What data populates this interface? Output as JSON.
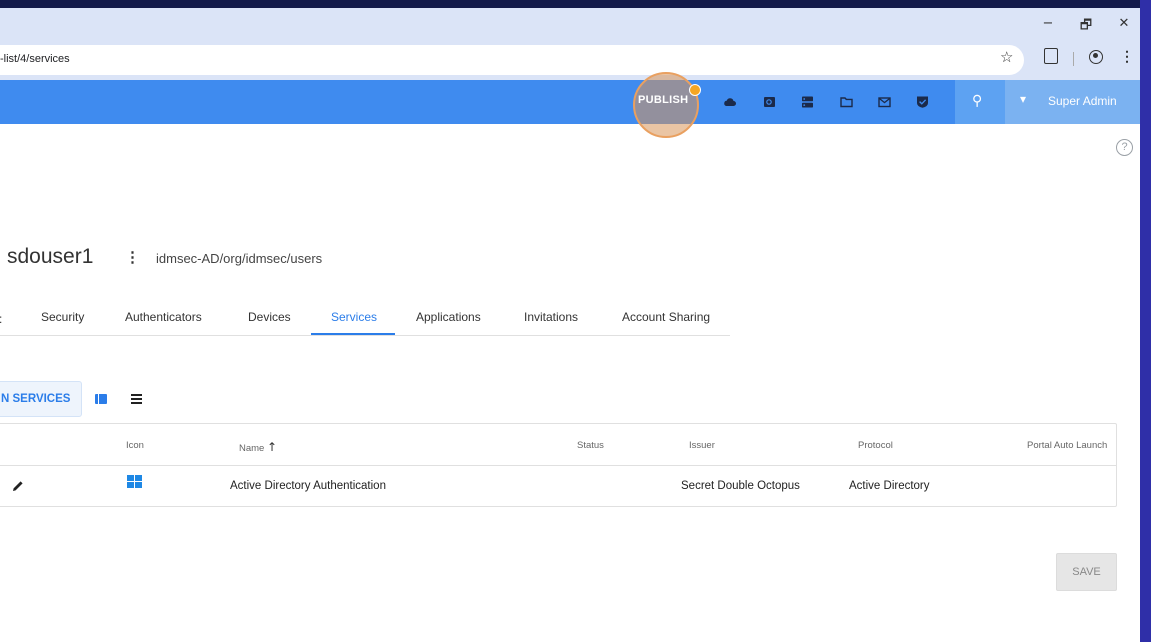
{
  "browser": {
    "url": "-list/4/services",
    "window_controls": {
      "minimize": "−",
      "restore": "🗗",
      "close": "✕"
    },
    "toolbar_icons": [
      "star-icon",
      "extensions-icon",
      "profile-icon",
      "menu-icon"
    ]
  },
  "header": {
    "publish_label": "PUBLISH",
    "nav_icons": [
      "cloud-icon",
      "search-doc-icon",
      "server-icon",
      "folder-icon",
      "mail-icon",
      "shield-check-icon"
    ],
    "search_icon": "search-icon",
    "admin_label": "Super Admin",
    "colors": {
      "bar": "#3f8bef",
      "search_zone": "#5da2f2",
      "admin_zone": "#7bb2f1",
      "publish_badge": "#f5a623"
    }
  },
  "user": {
    "name": "sdouser1",
    "menu_glyph": "⋮",
    "path": "idmsec-AD/org/idmsec/users"
  },
  "tabs": {
    "partial": ":",
    "items": [
      "Security",
      "Authenticators",
      "Devices",
      "Services",
      "Applications",
      "Invitations",
      "Account Sharing"
    ],
    "active": "Services"
  },
  "services": {
    "assign_label": "N SERVICES",
    "columns": {
      "icon": "Icon",
      "name": "Name",
      "name_sort": "↑",
      "status": "Status",
      "issuer": "Issuer",
      "protocol": "Protocol",
      "auto_launch": "Portal Auto Launch"
    },
    "rows": [
      {
        "icon": "windows-logo-icon",
        "name": "Active Directory Authentication",
        "status": "",
        "issuer": "Secret Double Octopus",
        "protocol": "Active Directory",
        "auto_launch": ""
      }
    ]
  },
  "save_label": "SAVE",
  "help_glyph": "?"
}
